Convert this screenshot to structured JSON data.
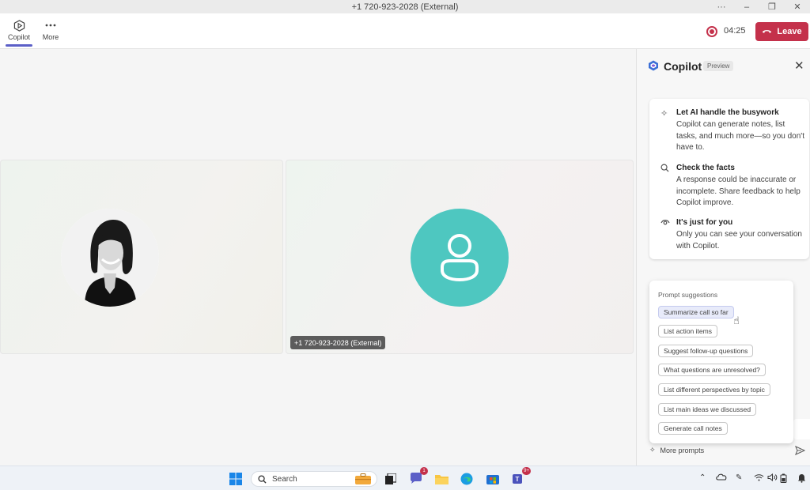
{
  "window": {
    "title": "+1 720-923-2028 (External)",
    "controls": {
      "more": "···",
      "minimize": "–",
      "restore": "❐",
      "close": "✕"
    }
  },
  "toolbar": {
    "copilot_label": "Copilot",
    "more_label": "More",
    "timer": "04:25",
    "leave_label": "Leave",
    "accent_color": "#5b5fc7",
    "leave_color": "#c4314b"
  },
  "stage": {
    "participant_tag": "+1 720-923-2028 (External)",
    "avatar_color": "#4ec7c0"
  },
  "copilot": {
    "title": "Copilot",
    "badge": "Preview",
    "info": [
      {
        "icon": "sparkle-icon",
        "title": "Let AI handle the busywork",
        "text": "Copilot can generate notes, list tasks, and much more—so you don't have to."
      },
      {
        "icon": "search-check-icon",
        "title": "Check the facts",
        "text": "A response could be inaccurate or incomplete. Share feedback to help Copilot improve."
      },
      {
        "icon": "eye-icon",
        "title": "It's just for you",
        "text": "Only you can see your conversation with Copilot."
      }
    ],
    "prompt_title": "Prompt suggestions",
    "prompts": [
      "Summarize call so far",
      "List action items",
      "Suggest follow-up questions",
      "What questions are unresolved?",
      "List different perspectives by topic",
      "List main ideas we discussed",
      "Generate call notes"
    ],
    "more_prompts": "More prompts"
  },
  "taskbar": {
    "search_label": "Search",
    "chat_badge": "1",
    "teams_badge": "9+"
  }
}
